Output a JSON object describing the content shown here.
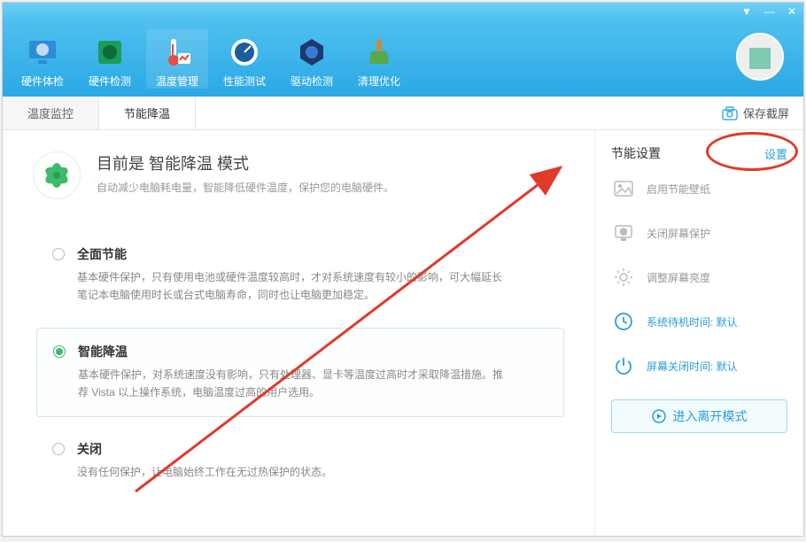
{
  "titlebar": {
    "pin": "▼",
    "min": "—",
    "close": "✕"
  },
  "nav": [
    {
      "label": "硬件体检"
    },
    {
      "label": "硬件检测"
    },
    {
      "label": "温度管理"
    },
    {
      "label": "性能测试"
    },
    {
      "label": "驱动检测"
    },
    {
      "label": "清理优化"
    }
  ],
  "tabs": [
    {
      "label": "温度监控"
    },
    {
      "label": "节能降温"
    }
  ],
  "save_screenshot": "保存截屏",
  "mode": {
    "title": "目前是 智能降温 模式",
    "desc": "自动减少电脑耗电量，智能降低硬件温度，保护您的电脑硬件。"
  },
  "options": [
    {
      "title": "全面节能",
      "desc": "基本硬件保护，只有使用电池或硬件温度较高时，才对系统速度有较小的影响，可大幅延长笔记本电脑使用时长或台式电脑寿命，同时也让电脑更加稳定。",
      "checked": false
    },
    {
      "title": "智能降温",
      "desc": "基本硬件保护，对系统速度没有影响，只有处理器、显卡等温度过高时才采取降温措施。推荐 Vista 以上操作系统，电脑温度过高的用户选用。",
      "checked": true
    },
    {
      "title": "关闭",
      "desc": "没有任何保护，让电脑始终工作在无过热保护的状态。",
      "checked": false
    }
  ],
  "sidebar": {
    "title": "节能设置",
    "settings": "设置",
    "items": [
      {
        "label": "启用节能壁纸",
        "accent": false
      },
      {
        "label": "关闭屏幕保护",
        "accent": false
      },
      {
        "label": "调整屏幕亮度",
        "accent": false
      },
      {
        "label": "系统待机时间: 默认",
        "accent": true
      },
      {
        "label": "屏幕关闭时间: 默认",
        "accent": true
      }
    ],
    "away_btn": "进入离开模式"
  }
}
